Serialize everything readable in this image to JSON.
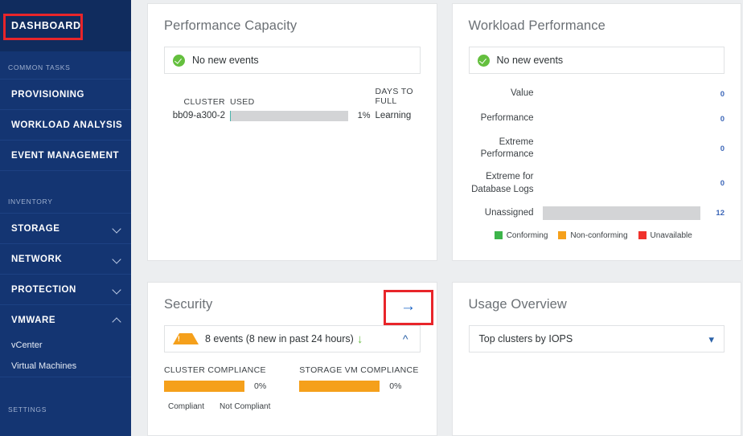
{
  "sidebar": {
    "active_item": {
      "label": "DASHBOARD",
      "name": "dashboard"
    },
    "sections": [
      {
        "heading": "COMMON TASKS",
        "items": [
          {
            "label": "PROVISIONING",
            "expandable": false
          },
          {
            "label": "WORKLOAD ANALYSIS",
            "expandable": false
          },
          {
            "label": "EVENT MANAGEMENT",
            "expandable": false
          }
        ]
      },
      {
        "heading": "INVENTORY",
        "items": [
          {
            "label": "STORAGE",
            "expandable": true,
            "chevron": "chevron-down-icon"
          },
          {
            "label": "NETWORK",
            "expandable": true,
            "chevron": "chevron-down-icon"
          },
          {
            "label": "PROTECTION",
            "expandable": true,
            "chevron": "chevron-down-icon"
          },
          {
            "label": "VMWARE",
            "expandable": true,
            "chevron": "chevron-up-icon",
            "children": [
              {
                "label": "vCenter"
              },
              {
                "label": "Virtual Machines"
              }
            ]
          }
        ]
      },
      {
        "heading": "SETTINGS",
        "items": []
      }
    ],
    "colors": {
      "background": "#143572",
      "active_background": "#102c5e",
      "heading": "#9fb0cf"
    }
  },
  "highlights": {
    "dashboard_box_color": "#e8252a",
    "security_arrow_box_color": "#e8252a"
  },
  "cards": {
    "performance_capacity": {
      "title": "Performance Capacity",
      "status": {
        "text": "No new events",
        "icon": "check-circle-icon",
        "color": "#64bf3e"
      },
      "columns": {
        "cluster": "CLUSTER",
        "used": "USED",
        "days_to_full_line1": "DAYS TO",
        "days_to_full_line2": "FULL"
      },
      "rows": [
        {
          "cluster": "bb09-a300-2",
          "used_percent": 1,
          "used_label": "1%",
          "days_to_full": "Learning"
        }
      ]
    },
    "workload_performance": {
      "title": "Workload Performance",
      "status": {
        "text": "No new events",
        "icon": "check-circle-icon",
        "color": "#64bf3e"
      },
      "rows": [
        {
          "label": "Value",
          "value": "0",
          "bar_percent": 0
        },
        {
          "label": "Performance",
          "value": "0",
          "bar_percent": 0
        },
        {
          "label": "Extreme\nPerformance",
          "label_line1": "Extreme",
          "label_line2": "Performance",
          "value": "0",
          "bar_percent": 0
        },
        {
          "label": "Extreme for\nDatabase Logs",
          "label_line1": "Extreme for",
          "label_line2": "Database Logs",
          "value": "0",
          "bar_percent": 0
        },
        {
          "label": "Unassigned",
          "value": "12",
          "bar_percent": 100
        }
      ],
      "legend": [
        {
          "label": "Conforming",
          "color": "#3cb44a"
        },
        {
          "label": "Non-conforming",
          "color": "#f5a01b"
        },
        {
          "label": "Unavailable",
          "color": "#f0322c"
        }
      ]
    },
    "security": {
      "title": "Security",
      "detail_arrow": "arrow-right-icon",
      "status": {
        "text": "8 events (8 new in past 24 hours)",
        "icon": "warning-triangle-icon",
        "color": "#f5a01b",
        "trend_icon": "arrow-down-icon",
        "trend_color": "#6cbf4b",
        "collapse_icon": "chevron-up-icon"
      },
      "compliance": [
        {
          "title": "CLUSTER COMPLIANCE",
          "percent_label": "0%",
          "not_compliant_percent": 100
        },
        {
          "title": "STORAGE VM COMPLIANCE",
          "percent_label": "0%",
          "not_compliant_percent": 100
        }
      ],
      "legend": [
        {
          "label": "Compliant",
          "color": "#3cb44a"
        },
        {
          "label": "Not Compliant",
          "color": "#f5a01b"
        }
      ]
    },
    "usage_overview": {
      "title": "Usage Overview",
      "selector": {
        "value": "Top clusters by IOPS",
        "icon": "chevron-down-icon"
      }
    }
  },
  "chart_data": [
    {
      "type": "bar",
      "title": "Performance Capacity",
      "orientation": "horizontal",
      "categories": [
        "bb09-a300-2"
      ],
      "values": [
        1
      ],
      "value_labels": [
        "1%"
      ],
      "extra_column": {
        "header": "DAYS TO FULL",
        "values": [
          "Learning"
        ]
      },
      "xlabel": "USED",
      "ylabel": "CLUSTER",
      "xlim": [
        0,
        100
      ],
      "grid": false
    },
    {
      "type": "bar",
      "title": "Workload Performance",
      "orientation": "horizontal",
      "categories": [
        "Value",
        "Performance",
        "Extreme Performance",
        "Extreme for Database Logs",
        "Unassigned"
      ],
      "values": [
        0,
        0,
        0,
        0,
        12
      ],
      "xlabel": "",
      "ylabel": "",
      "xlim": [
        0,
        12
      ],
      "grid": false,
      "legend": [
        "Conforming",
        "Non-conforming",
        "Unavailable"
      ],
      "legend_position": "bottom"
    },
    {
      "type": "bar",
      "title": "Security Compliance",
      "orientation": "horizontal",
      "categories": [
        "CLUSTER COMPLIANCE",
        "STORAGE VM COMPLIANCE"
      ],
      "series": [
        {
          "name": "Compliant",
          "values": [
            0,
            0
          ]
        },
        {
          "name": "Not Compliant",
          "values": [
            100,
            100
          ]
        }
      ],
      "value_labels": [
        "0%",
        "0%"
      ],
      "xlabel": "",
      "ylabel": "",
      "xlim": [
        0,
        100
      ],
      "grid": false,
      "legend": [
        "Compliant",
        "Not Compliant"
      ],
      "legend_position": "bottom"
    }
  ]
}
